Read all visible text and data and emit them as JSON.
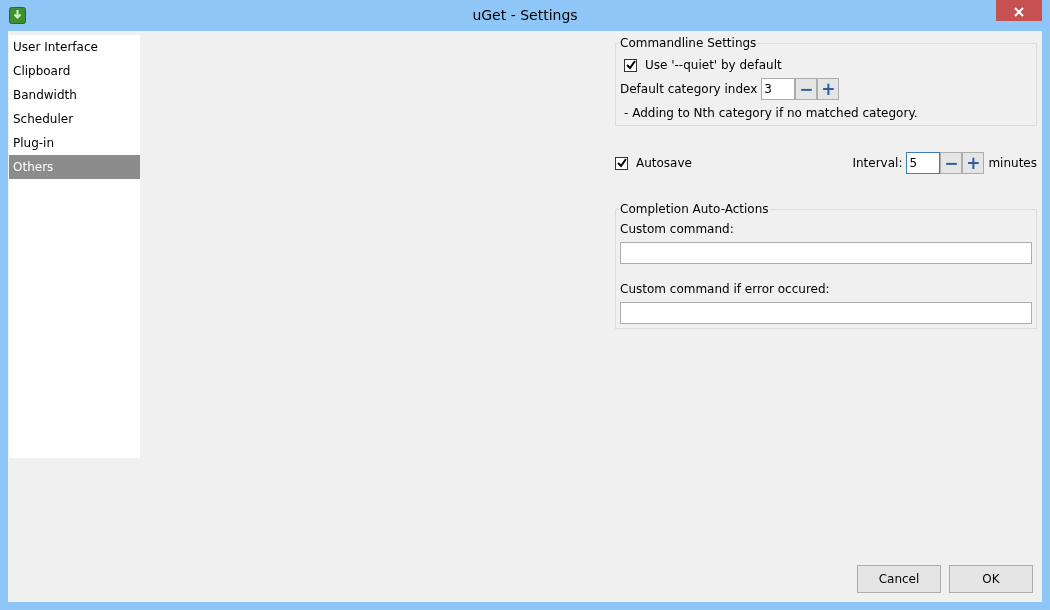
{
  "window": {
    "title": "uGet - Settings"
  },
  "sidebar": {
    "items": [
      {
        "label": "User Interface",
        "selected": false
      },
      {
        "label": "Clipboard",
        "selected": false
      },
      {
        "label": "Bandwidth",
        "selected": false
      },
      {
        "label": "Scheduler",
        "selected": false
      },
      {
        "label": "Plug-in",
        "selected": false
      },
      {
        "label": "Others",
        "selected": true
      }
    ]
  },
  "commandline": {
    "title": "Commandline Settings",
    "quiet": {
      "label": "Use '--quiet' by default",
      "checked": true
    },
    "category_label": "Default category index",
    "category_value": "3",
    "minus": "−",
    "plus": "+",
    "note": "-  Adding to Nth category if no matched category."
  },
  "autosave": {
    "label": "Autosave",
    "checked": true,
    "interval_label": "Interval:",
    "interval_value": "5",
    "minus": "−",
    "plus": "+",
    "unit": "minutes"
  },
  "completion": {
    "title": "Completion Auto-Actions",
    "command_label": "Custom command:",
    "error_label": "Custom command if error occured:"
  },
  "buttons": [
    "Cancel",
    "OK"
  ]
}
